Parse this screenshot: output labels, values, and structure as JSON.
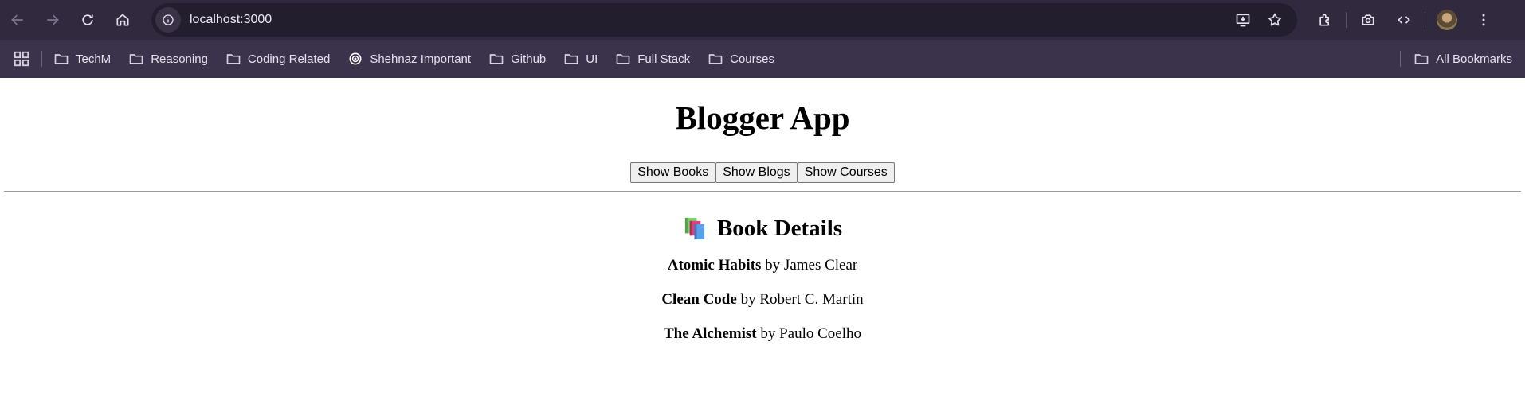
{
  "browser": {
    "url": "localhost:3000"
  },
  "bookmarks": {
    "items": [
      {
        "label": "TechM",
        "icon": "folder-icon"
      },
      {
        "label": "Reasoning",
        "icon": "folder-icon"
      },
      {
        "label": "Coding Related",
        "icon": "folder-icon"
      },
      {
        "label": "Shehnaz Important",
        "icon": "openai-icon"
      },
      {
        "label": "Github",
        "icon": "folder-icon"
      },
      {
        "label": "UI",
        "icon": "folder-icon"
      },
      {
        "label": "Full Stack",
        "icon": "folder-icon"
      },
      {
        "label": "Courses",
        "icon": "folder-icon"
      }
    ],
    "all_bookmarks": "All Bookmarks"
  },
  "app": {
    "title": "Blogger App",
    "buttons": {
      "books": "Show Books",
      "blogs": "Show Blogs",
      "courses": "Show Courses"
    },
    "section_title": "Book Details",
    "section_icon": "books-icon",
    "by_word": "by",
    "books": [
      {
        "title": "Atomic Habits",
        "author": "James Clear"
      },
      {
        "title": "Clean Code",
        "author": "Robert C. Martin"
      },
      {
        "title": "The Alchemist",
        "author": "Paulo Coelho"
      }
    ]
  }
}
